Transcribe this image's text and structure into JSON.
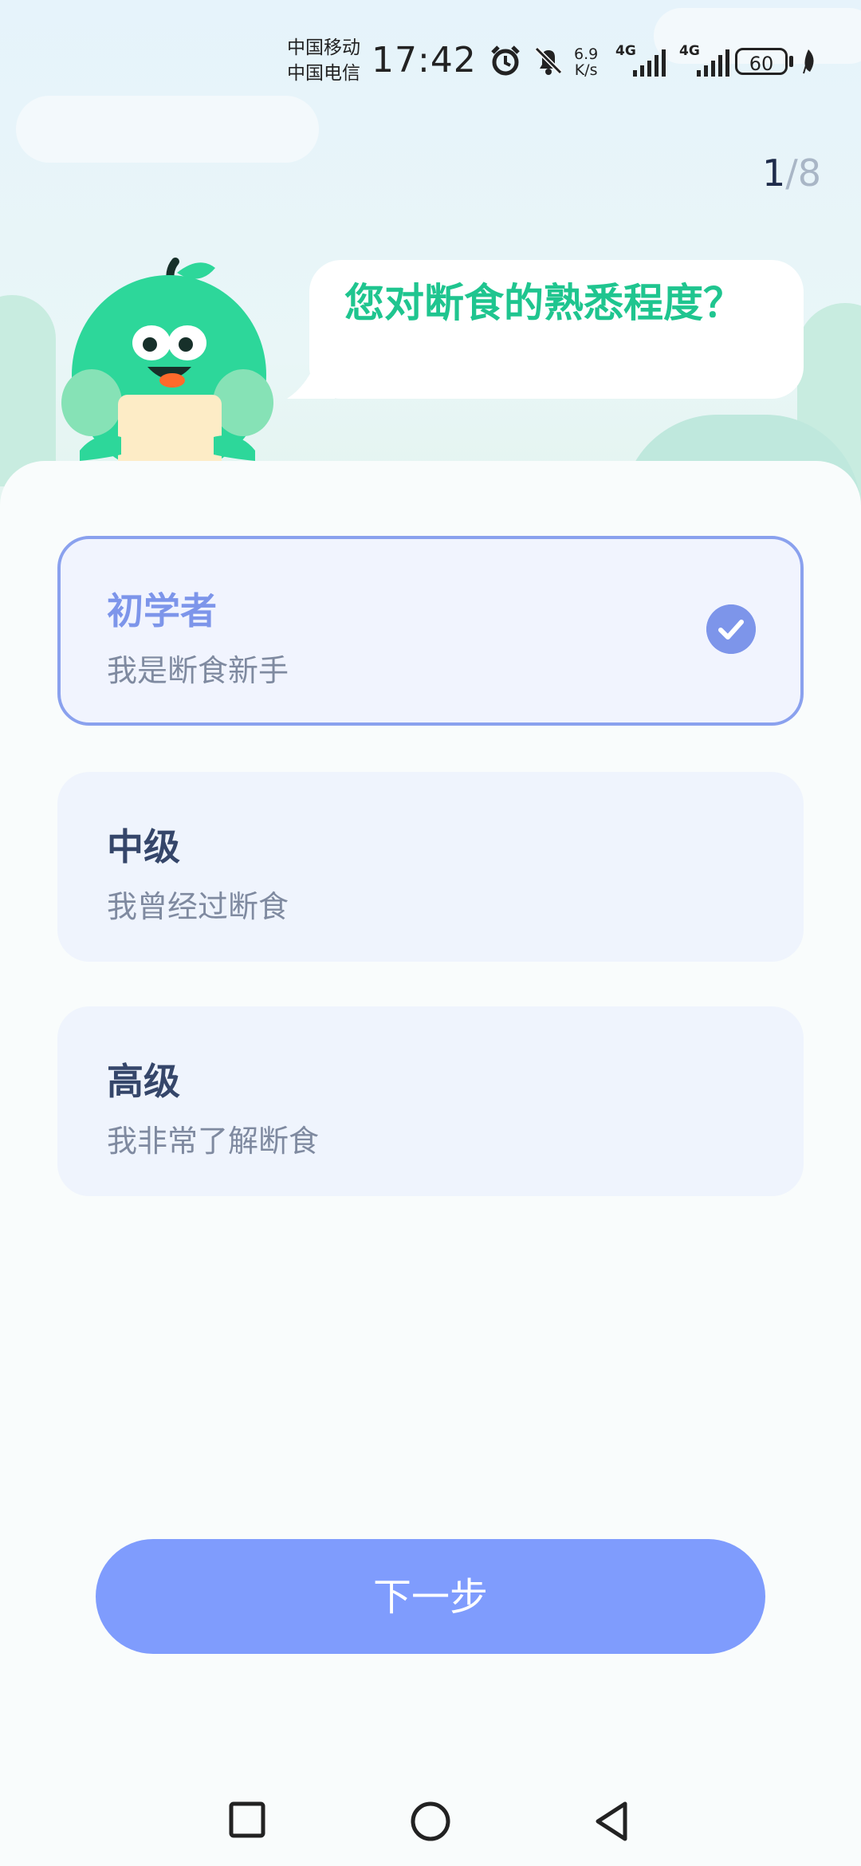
{
  "status_bar": {
    "carrier_1": "中国移动",
    "carrier_2": "中国电信",
    "time": "17:42",
    "net_speed_value": "6.9",
    "net_speed_unit": "K/s",
    "signal_1_label": "4G",
    "signal_2_label": "4G",
    "battery": "60",
    "icons": [
      "alarm-icon",
      "mute-bell-icon",
      "signal-icon",
      "signal-icon",
      "battery-icon",
      "leaf-icon"
    ]
  },
  "progress": {
    "current": "1",
    "separator": "/",
    "total": "8"
  },
  "question": {
    "text": "您对断食的熟悉程度？"
  },
  "options": [
    {
      "title": "初学者",
      "subtitle": "我是断食新手",
      "selected": true
    },
    {
      "title": "中级",
      "subtitle": "我曾经过断食",
      "selected": false
    },
    {
      "title": "高级",
      "subtitle": "我非常了解断食",
      "selected": false
    }
  ],
  "next_button": {
    "label": "下一步"
  },
  "navbar": {
    "icons": [
      "recent-apps-icon",
      "home-icon",
      "back-icon"
    ]
  },
  "colors": {
    "accent": "#7f9cfd",
    "selected_border": "#8aa1ee",
    "question_text": "#1fc58f",
    "mascot_green": "#2dd79a"
  }
}
